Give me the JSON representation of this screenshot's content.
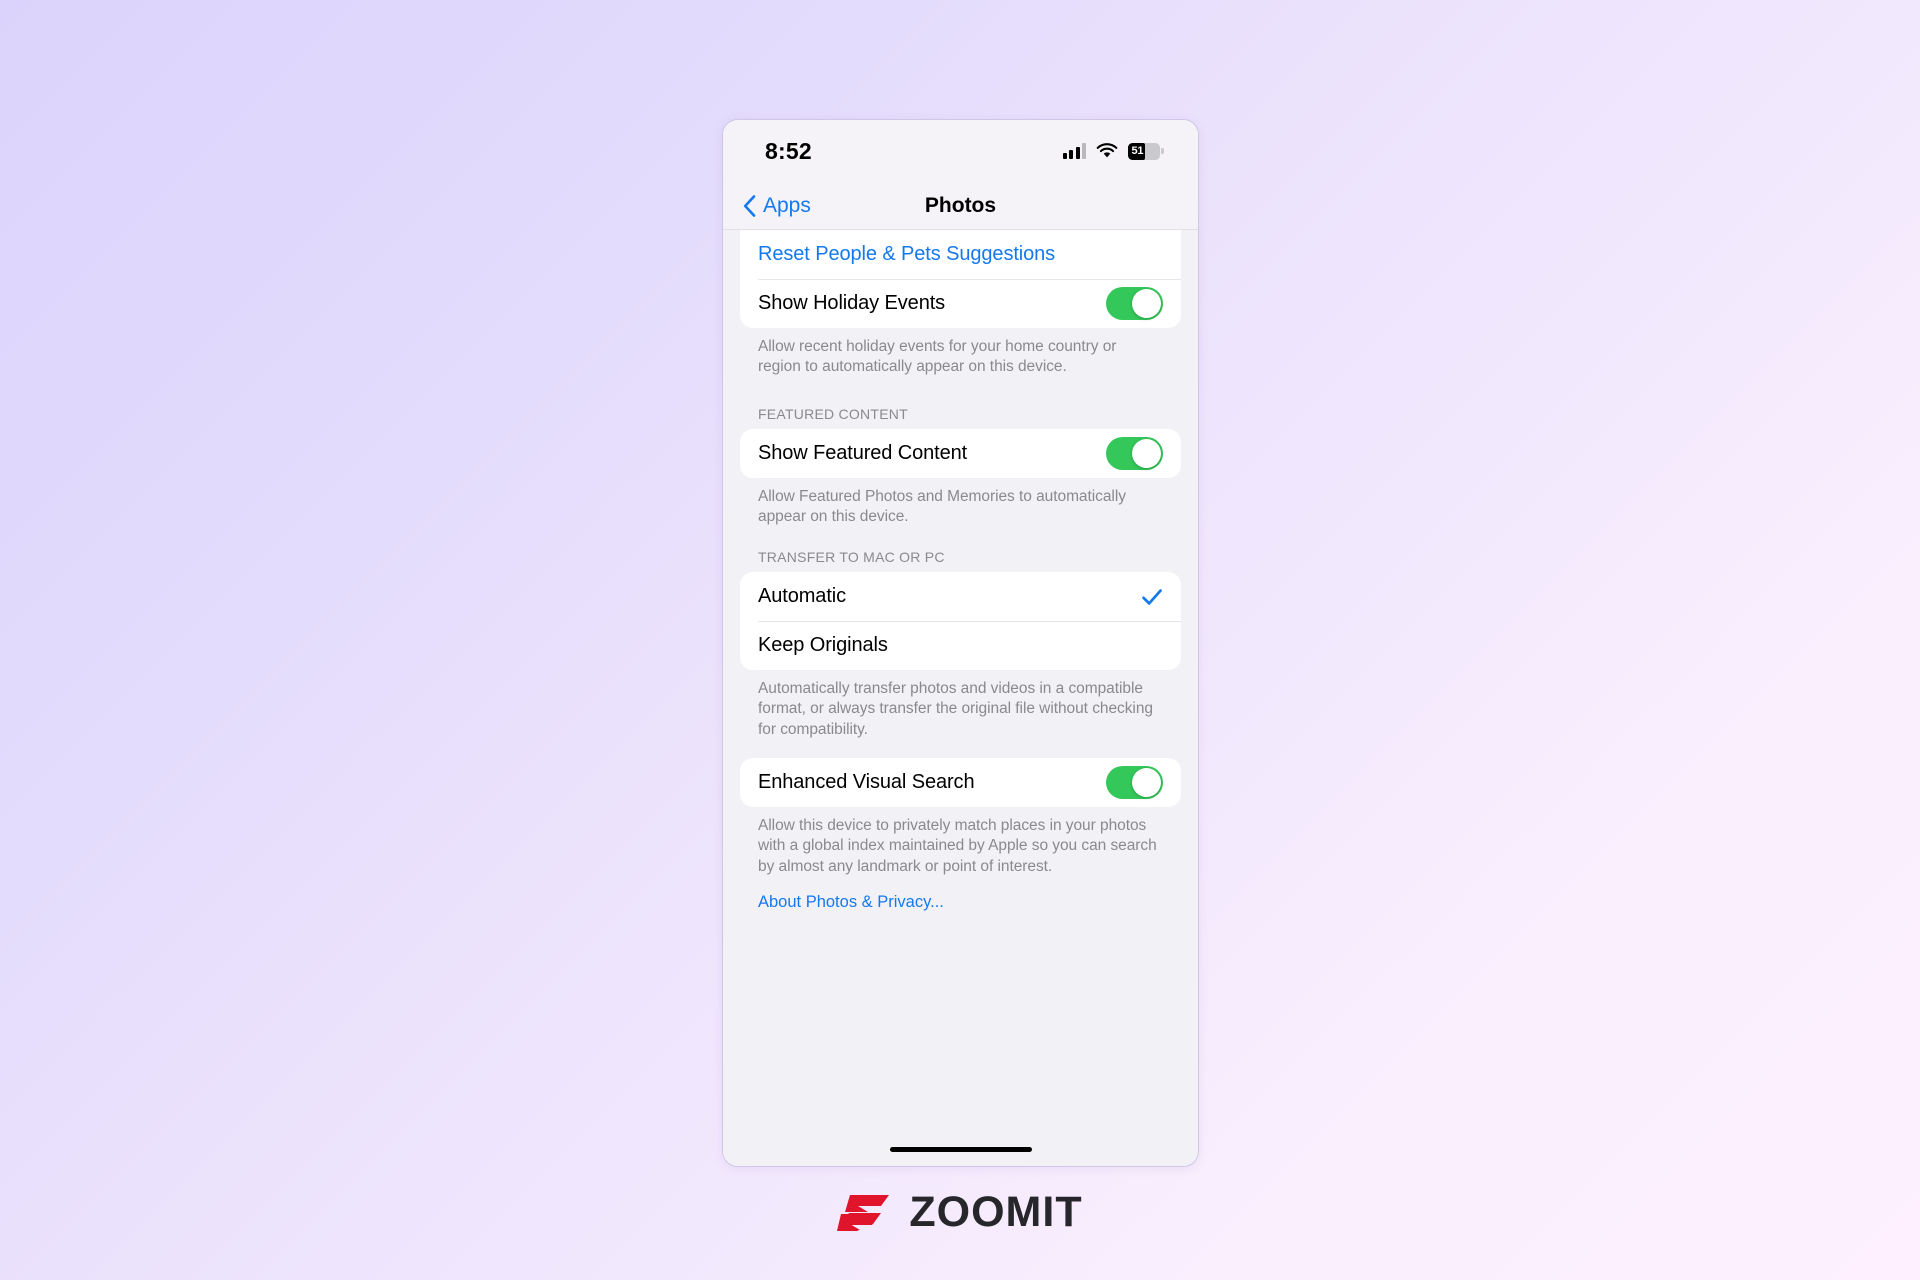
{
  "theme": {
    "accent_blue": "#1479ef",
    "toggle_green": "#34c759",
    "page_bg": "#f2f1f6",
    "footnote_gray": "#8a8a8e",
    "logo_red": "#e0142b",
    "logo_dark": "#26262b",
    "bg_gradient_start": "#dbd3fb",
    "bg_gradient_end": "#fef0fe"
  },
  "status_bar": {
    "time": "8:52",
    "cellular_icon": "cellular-bars-icon",
    "wifi_icon": "wifi-icon",
    "battery_icon": "battery-icon",
    "battery_percent": "51",
    "battery_fill_ratio": 52
  },
  "nav_bar": {
    "back_icon": "chevron-left-icon",
    "back_label": "Apps",
    "title": "Photos"
  },
  "sections": [
    {
      "id": "people-pets",
      "header": "",
      "rows": [
        {
          "name": "reset-people-pets-suggestions",
          "label": "Reset People & Pets Suggestions",
          "type": "link"
        },
        {
          "name": "show-holiday-events",
          "label": "Show Holiday Events",
          "type": "toggle",
          "value": true
        }
      ],
      "footnote": "Allow recent holiday events for your home country or region to automatically appear on this device."
    },
    {
      "id": "featured-content",
      "header": "FEATURED CONTENT",
      "rows": [
        {
          "name": "show-featured-content",
          "label": "Show Featured Content",
          "type": "toggle",
          "value": true
        }
      ],
      "footnote": "Allow Featured Photos and Memories to automatically appear on this device."
    },
    {
      "id": "transfer-to-mac-or-pc",
      "header": "TRANSFER TO MAC OR PC",
      "rows": [
        {
          "name": "transfer-option-automatic",
          "label": "Automatic",
          "type": "choice",
          "selected": true
        },
        {
          "name": "transfer-option-keep-originals",
          "label": "Keep Originals",
          "type": "choice",
          "selected": false
        }
      ],
      "footnote": "Automatically transfer photos and videos in a compatible format, or always transfer the original file without checking for compatibility."
    },
    {
      "id": "enhanced-visual-search",
      "header": "",
      "rows": [
        {
          "name": "enhanced-visual-search",
          "label": "Enhanced Visual Search",
          "type": "toggle",
          "value": true
        }
      ],
      "footnote": "Allow this device to privately match places in your photos with a global index maintained by Apple so you can search by almost any landmark or point of interest."
    }
  ],
  "about_link": "About Photos & Privacy...",
  "home_indicator": "home-indicator",
  "watermark": {
    "mark_icon": "zoomit-z-logo-icon",
    "text": "ZOOMIT"
  }
}
